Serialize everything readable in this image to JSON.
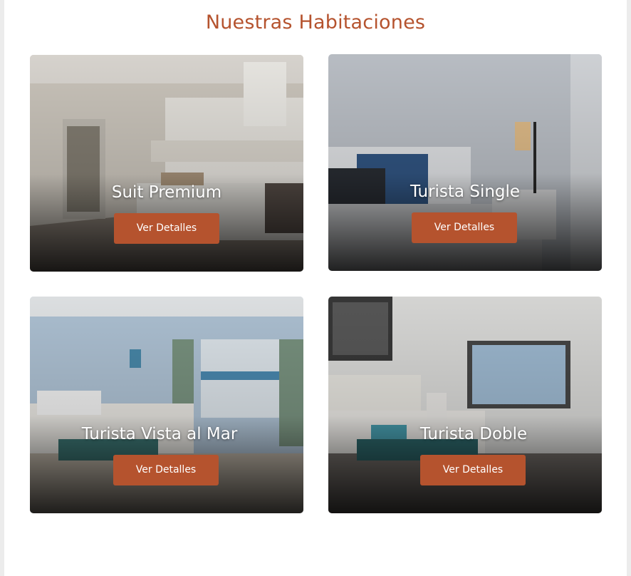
{
  "section": {
    "title": "Nuestras Habitaciones"
  },
  "rooms": [
    {
      "name": "Suit Premium",
      "button": "Ver Detalles"
    },
    {
      "name": "Turista Single",
      "button": "Ver Detalles"
    },
    {
      "name": "Turista Vista al Mar",
      "button": "Ver Detalles"
    },
    {
      "name": "Turista Doble",
      "button": "Ver Detalles"
    }
  ],
  "colors": {
    "accent": "#b5532e",
    "background": "#ffffff"
  }
}
